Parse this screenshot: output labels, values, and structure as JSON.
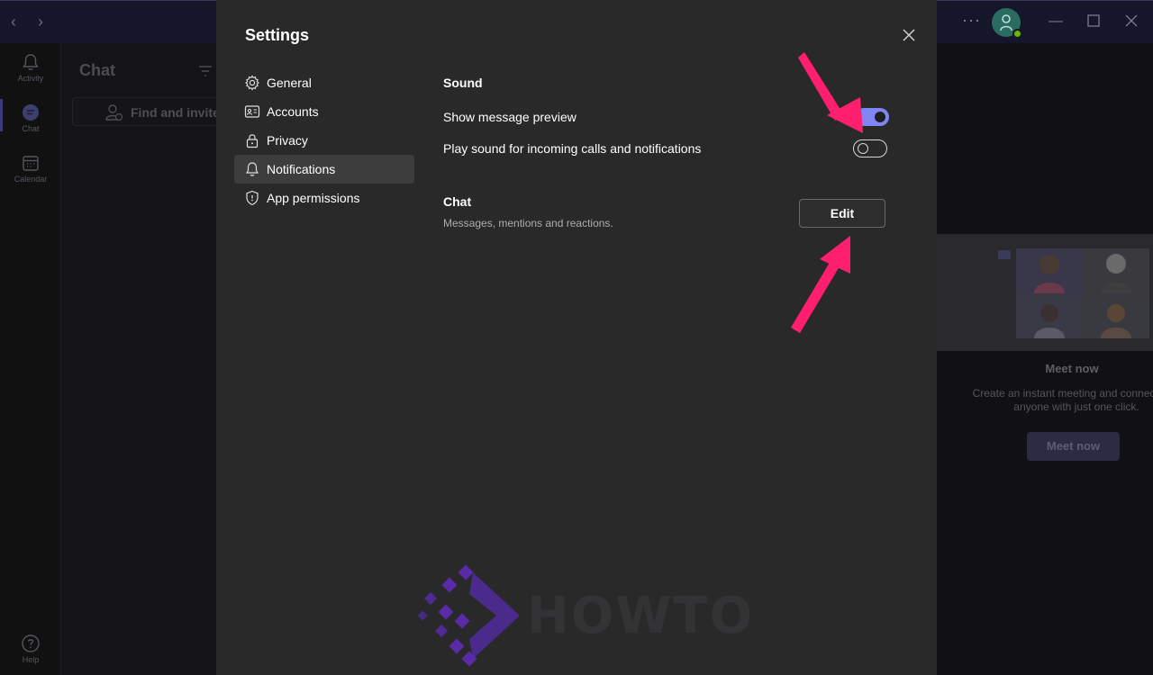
{
  "window": {
    "more_icon": "more-horizontal-icon",
    "status_color": "#6bb700"
  },
  "rail": {
    "items": [
      {
        "label": "Activity",
        "icon": "bell-icon"
      },
      {
        "label": "Chat",
        "icon": "chat-bubble-icon"
      },
      {
        "label": "Calendar",
        "icon": "calendar-icon"
      }
    ],
    "help_label": "Help"
  },
  "chat_panel": {
    "title": "Chat",
    "find_label": "Find and invite"
  },
  "meet_panel": {
    "title": "Meet now",
    "description": "Create an instant meeting and connect with anyone with just one click.",
    "button_label": "Meet now"
  },
  "settings": {
    "title": "Settings",
    "menu": [
      {
        "label": "General",
        "icon": "gear-icon",
        "active": false
      },
      {
        "label": "Accounts",
        "icon": "id-card-icon",
        "active": false
      },
      {
        "label": "Privacy",
        "icon": "lock-icon",
        "active": false
      },
      {
        "label": "Notifications",
        "icon": "bell-icon",
        "active": true
      },
      {
        "label": "App permissions",
        "icon": "shield-icon",
        "active": false
      }
    ],
    "sound": {
      "title": "Sound",
      "show_preview_label": "Show message preview",
      "show_preview_on": true,
      "play_sound_label": "Play sound for incoming calls and notifications",
      "play_sound_on": false
    },
    "chat": {
      "title": "Chat",
      "subtitle": "Messages, mentions and reactions.",
      "edit_label": "Edit"
    }
  },
  "colors": {
    "accent": "#7f85f5",
    "dialog_bg": "#292929",
    "annotation_arrow": "#ff1f6e"
  },
  "watermark": {
    "text": "HOWTO"
  }
}
